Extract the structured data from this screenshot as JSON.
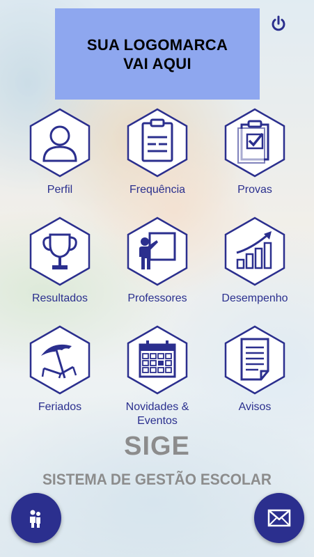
{
  "logo": {
    "line1": "SUA LOGOMARCA",
    "line2": "VAI AQUI"
  },
  "header": {
    "power_icon": "power-icon"
  },
  "tiles": [
    {
      "label": "Perfil",
      "icon": "user-icon"
    },
    {
      "label": "Frequência",
      "icon": "clipboard-icon"
    },
    {
      "label": "Provas",
      "icon": "clipboard-check-icon"
    },
    {
      "label": "Resultados",
      "icon": "trophy-icon"
    },
    {
      "label": "Professores",
      "icon": "teacher-board-icon"
    },
    {
      "label": "Desempenho",
      "icon": "growth-chart-icon"
    },
    {
      "label": "Feriados",
      "icon": "beach-umbrella-icon"
    },
    {
      "label": "Novidades & Eventos",
      "icon": "calendar-icon"
    },
    {
      "label": "Avisos",
      "icon": "document-icon"
    }
  ],
  "brand": {
    "title": "SIGE",
    "subtitle": "SISTEMA DE GESTÃO ESCOLAR"
  },
  "fabs": {
    "left_icon": "people-icon",
    "right_icon": "mail-icon"
  },
  "colors": {
    "primary": "#2b2f8e",
    "logo_bg": "#8ea7ef",
    "brand_text": "#8c8c8c"
  }
}
